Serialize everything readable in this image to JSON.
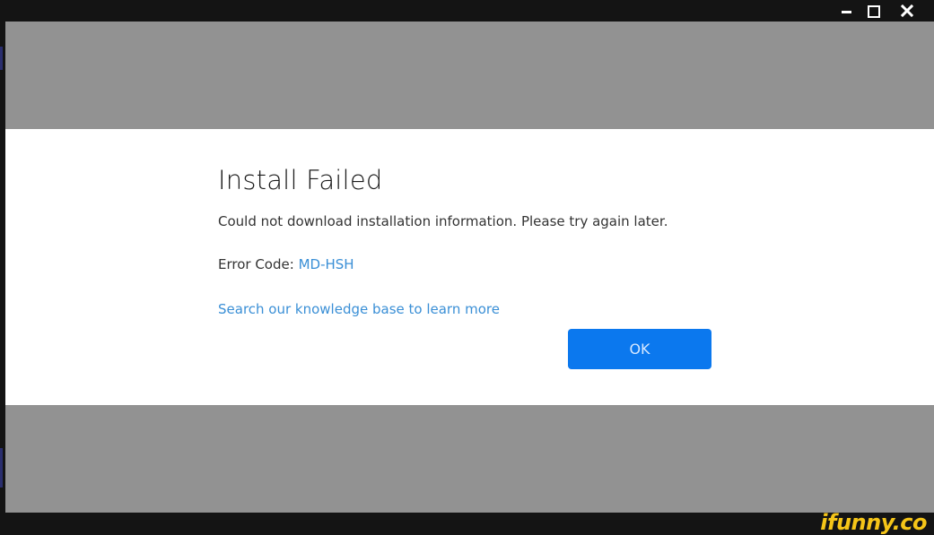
{
  "window": {
    "controls": {
      "minimize_icon": "minimize-icon",
      "maximize_icon": "maximize-icon",
      "close_icon": "close-icon"
    }
  },
  "dialog": {
    "title": "Install Failed",
    "message": "Could not download installation information. Please try again later.",
    "error_label": "Error Code:",
    "error_code": "MD-HSH",
    "link_text": "Search our knowledge base to learn more",
    "ok_label": "OK"
  },
  "watermark": {
    "text": "ifunny.co"
  },
  "colors": {
    "overlay": "#929292",
    "dialog_bg": "#ffffff",
    "accent": "#0b78ee",
    "link": "#3a8fd6",
    "titlebar": "#141414",
    "watermark": "#f5c518"
  }
}
